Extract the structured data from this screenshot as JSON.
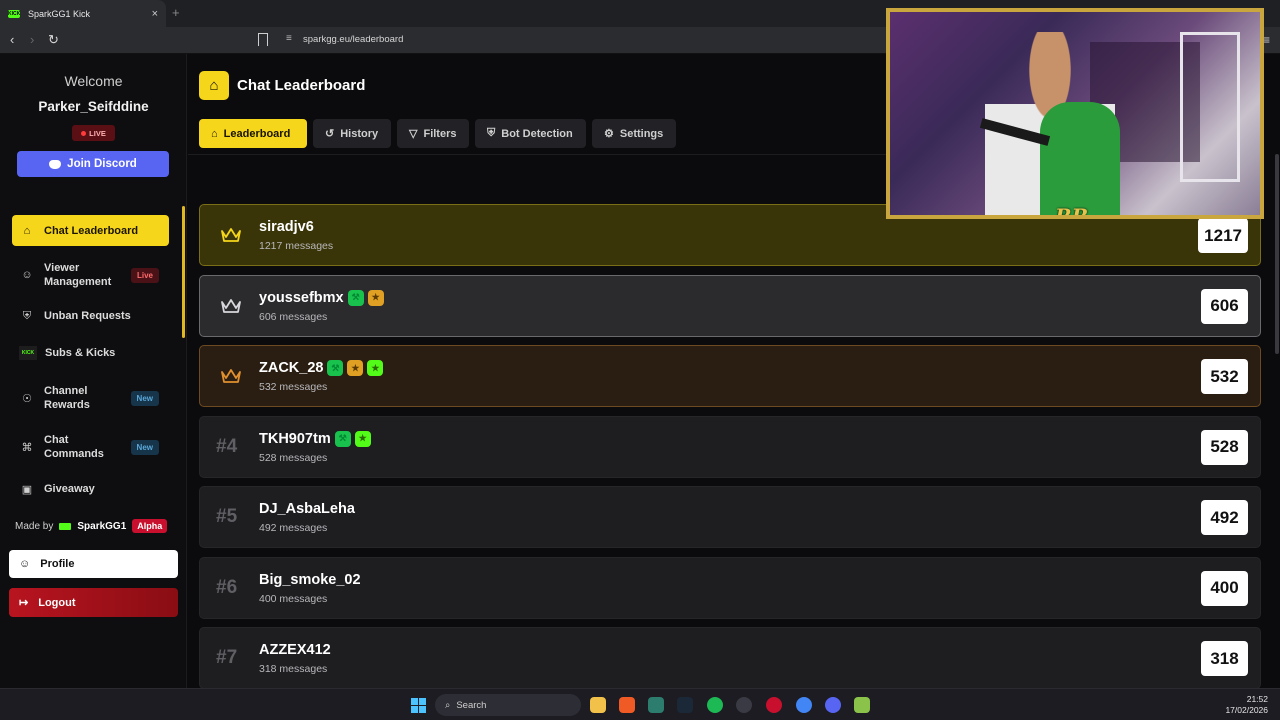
{
  "browser": {
    "tab_title": "SparkGG1 Kick",
    "tab_close": "×",
    "new_tab": "+",
    "url": "sparkgg.eu/leaderboard",
    "favicon_text": "KICK"
  },
  "sidebar": {
    "welcome": "Welcome",
    "username": "Parker_Seifddine",
    "live_badge": "LIVE",
    "discord_button": "Join Discord",
    "items": [
      {
        "label": "Chat Leaderboard",
        "icon": "trophy-icon",
        "active": true
      },
      {
        "label": "Viewer\nManagement",
        "icon": "users-icon",
        "pill": "Live"
      },
      {
        "label": "Unban Requests",
        "icon": "shield-icon"
      },
      {
        "label": "Subs & Kicks",
        "icon": "kick-icon"
      },
      {
        "label": "Channel\nRewards",
        "icon": "award-icon",
        "pill": "New"
      },
      {
        "label": "Chat\nCommands",
        "icon": "command-icon",
        "pill": "New"
      },
      {
        "label": "Giveaway",
        "icon": "gift-icon"
      }
    ],
    "made_by": "Made by",
    "made_by_name": "SparkGG1",
    "alpha": "Alpha",
    "profile": "Profile",
    "logout": "Logout"
  },
  "main": {
    "title": "Chat Leaderboard",
    "tabs": [
      {
        "label": "Leaderboard",
        "icon": "trophy-icon",
        "active": true
      },
      {
        "label": "History",
        "icon": "history-icon"
      },
      {
        "label": "Filters",
        "icon": "filter-icon"
      },
      {
        "label": "Bot Detection",
        "icon": "shield-icon"
      },
      {
        "label": "Settings",
        "icon": "gear-icon"
      }
    ],
    "rows": [
      {
        "rank": "",
        "tier": "gold",
        "name": "siradjv6",
        "messages": "1217 messages",
        "count": "1217",
        "badges": []
      },
      {
        "rank": "",
        "tier": "silver",
        "name": "youssefbmx",
        "messages": "606 messages",
        "count": "606",
        "badges": [
          "green",
          "orange"
        ]
      },
      {
        "rank": "",
        "tier": "bronze",
        "name": "ZACK_28",
        "messages": "532 messages",
        "count": "532",
        "badges": [
          "green",
          "orange",
          "lime"
        ]
      },
      {
        "rank": "#4",
        "tier": "",
        "name": "TKH907tm",
        "messages": "528 messages",
        "count": "528",
        "badges": [
          "green",
          "lime"
        ]
      },
      {
        "rank": "#5",
        "tier": "",
        "name": "DJ_AsbaLeha",
        "messages": "492 messages",
        "count": "492",
        "badges": []
      },
      {
        "rank": "#6",
        "tier": "",
        "name": "Big_smoke_02",
        "messages": "400 messages",
        "count": "400",
        "badges": []
      },
      {
        "rank": "#7",
        "tier": "",
        "name": "AZZEX412",
        "messages": "318 messages",
        "count": "318",
        "badges": []
      }
    ]
  },
  "webcam": {
    "logo": "RR"
  },
  "taskbar": {
    "search": "Search",
    "time": "21:52",
    "date": "17/02/2026"
  },
  "colors": {
    "accent": "#f6d61b",
    "discord": "#5865f2",
    "logout": "#b8141f",
    "kick": "#53fc18"
  }
}
